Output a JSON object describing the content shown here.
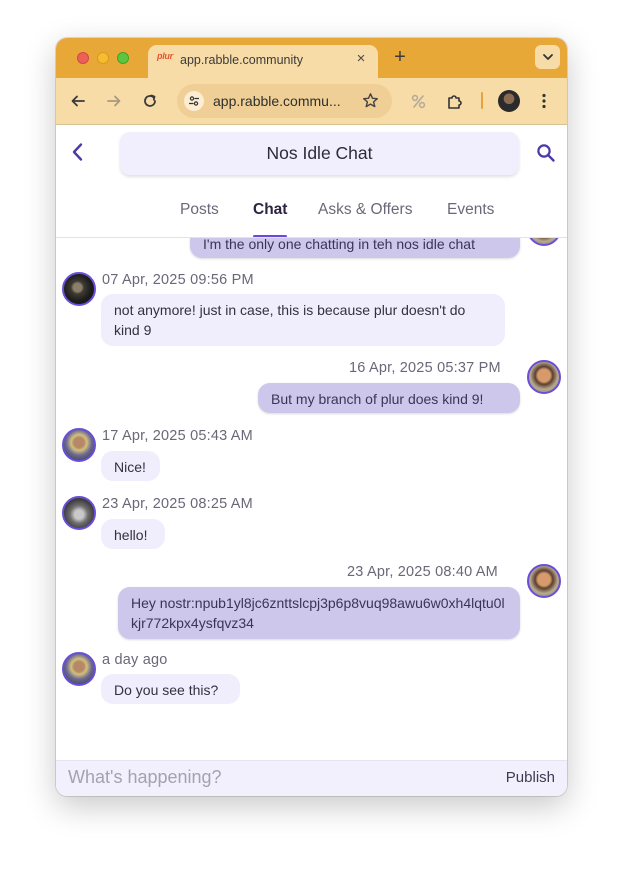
{
  "browser": {
    "tab_favicon": "plur",
    "tab_title": "app.rabble.community",
    "tab_close": "×",
    "new_tab": "+",
    "url": "app.rabble.commu...",
    "window_controls": [
      "close",
      "minimize",
      "zoom"
    ],
    "toolbar_icons": [
      "back-icon",
      "forward-icon",
      "reload-icon",
      "tune-icon",
      "bookmark-star-icon",
      "percent-extension-icon",
      "puzzle-extensions-icon",
      "profile-avatar",
      "kebab-menu-icon"
    ]
  },
  "header": {
    "title": "Nos Idle Chat"
  },
  "tabs": [
    {
      "label": "Posts"
    },
    {
      "label": "Chat",
      "active": true
    },
    {
      "label": "Asks & Offers"
    },
    {
      "label": "Events"
    }
  ],
  "messages": [
    {
      "direction": "out",
      "timestamp": "",
      "text": "I'm the only one chatting in teh nos idle chat"
    },
    {
      "direction": "in",
      "timestamp": "07 Apr, 2025 09:56 PM",
      "text": "not anymore! just in case, this is because plur doesn't do kind 9"
    },
    {
      "direction": "out",
      "timestamp": "16 Apr, 2025 05:37 PM",
      "text": "But my branch of plur does kind 9!"
    },
    {
      "direction": "in",
      "timestamp": "17 Apr, 2025 05:43 AM",
      "text": "Nice!"
    },
    {
      "direction": "in",
      "timestamp": "23 Apr, 2025 08:25 AM",
      "text": "hello!"
    },
    {
      "direction": "out",
      "timestamp": "23 Apr, 2025 08:40 AM",
      "text": "Hey nostr:npub1yl8jc6znttslcpj3p6p8vuq98awu6w0xh4lqtu0lkjr772kpx4ysfqvz34"
    },
    {
      "direction": "in",
      "timestamp": "a day ago",
      "text": "Do you see this?"
    }
  ],
  "composer": {
    "placeholder": "What's happening?",
    "publish_label": "Publish",
    "tools": [
      "image-icon",
      "add-emoji-icon",
      "emoji-icon",
      "mention-icon",
      "quote-icon",
      "hashtag-icon",
      "zap-icon",
      "code-icon",
      "warning-icon",
      "text-format-icon"
    ]
  },
  "colors": {
    "browser_frame": "#e8a838",
    "browser_toolbar": "#f7dca8",
    "accent": "#6c47d9",
    "incoming_bubble": "#f0edfc",
    "outgoing_bubble": "#cdc7ec"
  }
}
